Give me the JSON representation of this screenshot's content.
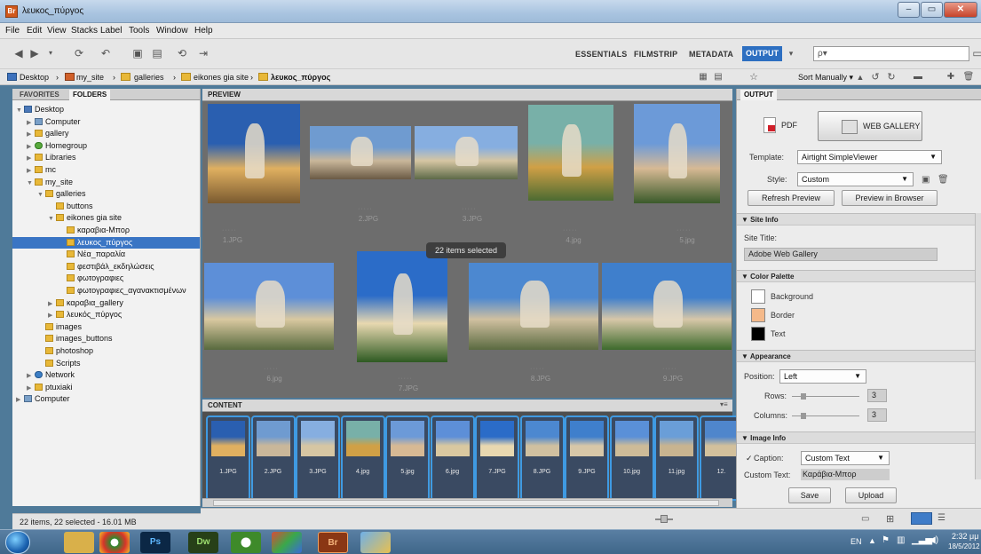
{
  "window": {
    "title": "λευκος_πύργος",
    "app_icon": "Br",
    "minimize": "‒",
    "maximize": "▭",
    "close": "✕"
  },
  "menu": [
    "File",
    "Edit",
    "View",
    "Stacks",
    "Label",
    "Tools",
    "Window",
    "Help"
  ],
  "workspaces": {
    "essentials": "ESSENTIALS",
    "filmstrip": "FILMSTRIP",
    "metadata": "METADATA",
    "output": "OUTPUT",
    "search_placeholder": "ρ▾"
  },
  "path": [
    "Desktop",
    "my_site",
    "galleries",
    "eikones gia site",
    "λευκος_πύργος"
  ],
  "sort": {
    "label": "Sort Manually ▾"
  },
  "left_panel": {
    "tabs": {
      "favorites": "FAVORITES",
      "folders": "FOLDERS"
    },
    "tree": [
      {
        "label": "Desktop",
        "indent": 0,
        "icon": "blue",
        "arrow": "▼"
      },
      {
        "label": "Computer",
        "indent": 1,
        "icon": "pc",
        "arrow": "▶"
      },
      {
        "label": "gallery",
        "indent": 1,
        "icon": "folder",
        "arrow": "▶"
      },
      {
        "label": "Homegroup",
        "indent": 1,
        "icon": "grp",
        "arrow": "▶"
      },
      {
        "label": "Libraries",
        "indent": 1,
        "icon": "folder",
        "arrow": "▶"
      },
      {
        "label": "mc",
        "indent": 1,
        "icon": "folder",
        "arrow": "▶"
      },
      {
        "label": "my_site",
        "indent": 1,
        "icon": "folder",
        "arrow": "▼"
      },
      {
        "label": "galleries",
        "indent": 2,
        "icon": "folder",
        "arrow": "▼"
      },
      {
        "label": "buttons",
        "indent": 3,
        "icon": "folder",
        "arrow": ""
      },
      {
        "label": "eikones gia site",
        "indent": 3,
        "icon": "folder",
        "arrow": "▼"
      },
      {
        "label": "καραβια-Μπορ",
        "indent": 4,
        "icon": "folder",
        "arrow": ""
      },
      {
        "label": "λευκος_πύργος",
        "indent": 4,
        "icon": "folder",
        "arrow": "",
        "selected": true
      },
      {
        "label": "Νέα_παραλία",
        "indent": 4,
        "icon": "folder",
        "arrow": ""
      },
      {
        "label": "φεστιβάλ_εκδηλώσεις",
        "indent": 4,
        "icon": "folder",
        "arrow": ""
      },
      {
        "label": "φωτογραφιες",
        "indent": 4,
        "icon": "folder",
        "arrow": ""
      },
      {
        "label": "φωτογραφιες_αγανακτισμένων",
        "indent": 4,
        "icon": "folder",
        "arrow": ""
      },
      {
        "label": "καραβια_gallery",
        "indent": 3,
        "icon": "folder",
        "arrow": "▶"
      },
      {
        "label": "λευκός_πύργος",
        "indent": 3,
        "icon": "folder",
        "arrow": "▶"
      },
      {
        "label": "images",
        "indent": 2,
        "icon": "folder",
        "arrow": ""
      },
      {
        "label": "images_buttons",
        "indent": 2,
        "icon": "folder",
        "arrow": ""
      },
      {
        "label": "photoshop",
        "indent": 2,
        "icon": "folder",
        "arrow": ""
      },
      {
        "label": "Scripts",
        "indent": 2,
        "icon": "folder",
        "arrow": ""
      },
      {
        "label": "Network",
        "indent": 1,
        "icon": "net",
        "arrow": "▶"
      },
      {
        "label": "ptuxiaki",
        "indent": 1,
        "icon": "folder",
        "arrow": "▶"
      },
      {
        "label": "Computer",
        "indent": 0,
        "icon": "pc",
        "arrow": "▶"
      }
    ],
    "status": "22 items, 22 selected - 16.01 MB"
  },
  "preview": {
    "header": "PREVIEW",
    "selection_tip": "22 items selected",
    "items": [
      {
        "label": "1.JPG",
        "colors": [
          "#2a5fb0",
          "#e0b060",
          "#7a5a30"
        ]
      },
      {
        "label": "2.JPG",
        "colors": [
          "#6f9bd0",
          "#c9b79a",
          "#6a5a45"
        ]
      },
      {
        "label": "3.JPG",
        "colors": [
          "#86aee0",
          "#d6c6a3",
          "#5d6a48"
        ]
      },
      {
        "label": "4.jpg",
        "colors": [
          "#78b0a8",
          "#d0a046",
          "#4c6b32"
        ]
      },
      {
        "label": "5.jpg",
        "colors": [
          "#6c9ad8",
          "#d7b994",
          "#3a5a2a"
        ]
      },
      {
        "label": "6.jpg",
        "colors": [
          "#5d8fd8",
          "#d9c8a0",
          "#586a3e"
        ]
      },
      {
        "label": "7.JPG",
        "colors": [
          "#2b6cc8",
          "#e8d8b0",
          "#2e5a22"
        ]
      },
      {
        "label": "8.JPG",
        "colors": [
          "#4c88d0",
          "#d0c0a0",
          "#5a6a40"
        ]
      },
      {
        "label": "9.JPG",
        "colors": [
          "#3f7fcc",
          "#d7c7a8",
          "#3d6a2c"
        ]
      }
    ]
  },
  "content": {
    "header": "CONTENT",
    "items": [
      {
        "label": "1.JPG",
        "colors": [
          "#2a5fb0",
          "#e0b060"
        ]
      },
      {
        "label": "2.JPG",
        "colors": [
          "#6f9bd0",
          "#c9b79a"
        ]
      },
      {
        "label": "3.JPG",
        "colors": [
          "#86aee0",
          "#d6c6a3"
        ]
      },
      {
        "label": "4.jpg",
        "colors": [
          "#78b0a8",
          "#d0a046"
        ]
      },
      {
        "label": "5.jpg",
        "colors": [
          "#6c9ad8",
          "#d7b994"
        ]
      },
      {
        "label": "6.jpg",
        "colors": [
          "#5d8fd8",
          "#d9c8a0"
        ]
      },
      {
        "label": "7.JPG",
        "colors": [
          "#2b6cc8",
          "#e8d8b0"
        ]
      },
      {
        "label": "8.JPG",
        "colors": [
          "#4c88d0",
          "#d0c0a0"
        ]
      },
      {
        "label": "9.JPG",
        "colors": [
          "#3f7fcc",
          "#d7c7a8"
        ]
      },
      {
        "label": "10.jpg",
        "colors": [
          "#5a90d8",
          "#cdbb98"
        ]
      },
      {
        "label": "11.jpg",
        "colors": [
          "#6a9ed8",
          "#c8b490"
        ]
      },
      {
        "label": "12.",
        "colors": [
          "#4f86cc",
          "#d2c09c"
        ]
      }
    ]
  },
  "output": {
    "header": "OUTPUT",
    "pdf_label": "PDF",
    "web_gallery_label": "WEB GALLERY",
    "template_label": "Template:",
    "template_value": "Airtight SimpleViewer",
    "style_label": "Style:",
    "style_value": "Custom",
    "refresh_label": "Refresh Preview",
    "preview_browser_label": "Preview in Browser",
    "site_info": {
      "header": "▼ Site Info",
      "title_label": "Site Title:",
      "title_value": "Adobe Web Gallery"
    },
    "color_palette": {
      "header": "▼ Color Palette",
      "items": [
        {
          "label": "Background",
          "color": "#ffffff"
        },
        {
          "label": "Border",
          "color": "#f4b98a"
        },
        {
          "label": "Text",
          "color": "#000000"
        }
      ]
    },
    "appearance": {
      "header": "▼ Appearance",
      "position_label": "Position:",
      "position_value": "Left",
      "rows_label": "Rows:",
      "rows_value": "3",
      "columns_label": "Columns:",
      "columns_value": "3"
    },
    "image_info": {
      "header": "▼ Image Info",
      "caption_label": "Caption:",
      "caption_value": "Custom Text",
      "caption_checked": "✓",
      "custom_text_label": "Custom Text:",
      "custom_text_value": "Καράβια-Μπορ"
    },
    "save_label": "Save",
    "upload_label": "Upload"
  },
  "taskbar": {
    "lang": "EN",
    "time": "2:32 μμ",
    "date": "18/5/2012",
    "apps": [
      "Ps",
      "Dw",
      "Br"
    ]
  }
}
